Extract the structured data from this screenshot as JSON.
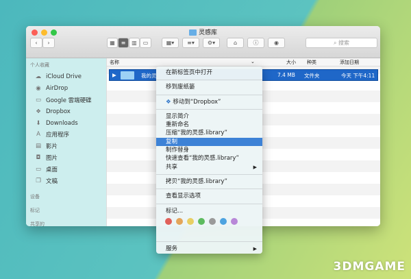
{
  "window": {
    "title": "灵感库",
    "search_placeholder": "搜索"
  },
  "toolbar": {
    "nav_back": "‹",
    "nav_forward": "›",
    "icons": [
      "icon-view",
      "list-view",
      "column-view",
      "coverflow-view",
      "arrange",
      "sort",
      "action",
      "new-folder",
      "info",
      "quicklook"
    ]
  },
  "sidebar": {
    "sections": {
      "favorites": "个人收藏",
      "devices": "设备",
      "tags": "标记",
      "shared": "共享的"
    },
    "items": [
      {
        "label": "iCloud Drive",
        "icon": "☁"
      },
      {
        "label": "AirDrop",
        "icon": "◉"
      },
      {
        "label": "Google 雲端硬碟",
        "icon": "▭"
      },
      {
        "label": "Dropbox",
        "icon": "❖"
      },
      {
        "label": "Downloads",
        "icon": "⬇"
      },
      {
        "label": "应用程序",
        "icon": "A"
      },
      {
        "label": "影片",
        "icon": "▤"
      },
      {
        "label": "图片",
        "icon": "◘"
      },
      {
        "label": "桌面",
        "icon": "▭"
      },
      {
        "label": "文稿",
        "icon": "❐"
      }
    ]
  },
  "columns": {
    "name": "名称",
    "size": "大小",
    "kind": "种类",
    "date": "添加日期"
  },
  "file": {
    "name": "我的灵",
    "size": "7.4 MB",
    "kind": "文件夹",
    "date": "今天 下午4:11"
  },
  "menu": {
    "open_tab": "在新标签页中打开",
    "trash": "移到废纸篓",
    "dropbox": "移动到“Dropbox”",
    "info": "显示简介",
    "rename": "重新命名",
    "compress": "压缩“我的灵感.library”",
    "duplicate": "复制",
    "alias": "制作替身",
    "quicklook": "快速查看“我的灵感.library”",
    "share": "共享",
    "copy": "拷贝“我的灵感.library”",
    "view_options": "查看显示选项",
    "tags": "标记...",
    "services": "服务",
    "tag_colors": [
      "#e0605a",
      "#e3a55a",
      "#e8cf63",
      "#5dbb5f",
      "#9a9a9a",
      "#4da3e0",
      "#b887d8"
    ]
  },
  "watermark": "3DMGAME"
}
